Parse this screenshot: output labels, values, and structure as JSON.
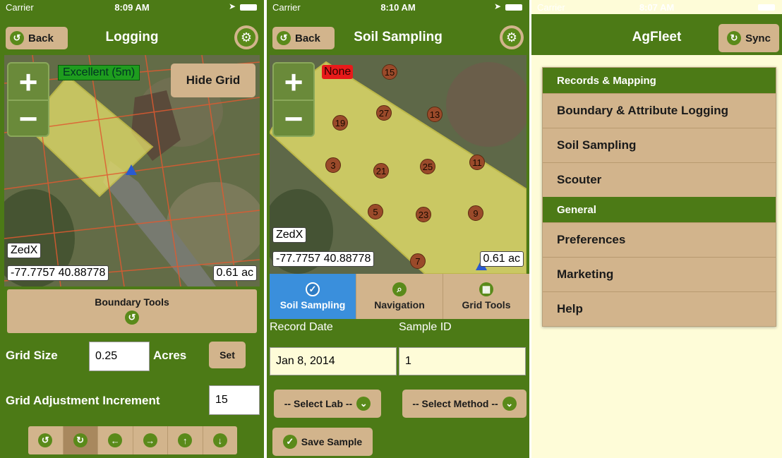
{
  "colors": {
    "nav_green": "#4c7a16",
    "tan": "#d2b48c",
    "tab_active_blue": "#3a8fdc",
    "accuracy_green": "#1e9d1e",
    "accuracy_red": "#e81a1a",
    "background_cream": "#fefcd8"
  },
  "logging": {
    "status": {
      "carrier": "Carrier",
      "time": "8:09 AM"
    },
    "back_label": "Back",
    "title": "Logging",
    "map": {
      "accuracy": "Excellent (5m)",
      "hide_grid": "Hide Grid",
      "provider": "ZedX",
      "coords": "-77.7757 40.88778",
      "area": "0.61 ac",
      "zoom_in": "+",
      "zoom_out": "−"
    },
    "boundary_tools": "Boundary Tools",
    "grid_size_label": "Grid Size",
    "grid_size_value": "0.25",
    "units": "Acres",
    "set_label": "Set",
    "increment_label": "Grid Adjustment Increment",
    "increment_value": "15",
    "arrow_icons": [
      "undo-icon",
      "redo-icon",
      "arrow-left-icon",
      "arrow-right-icon",
      "arrow-up-icon",
      "arrow-down-icon"
    ]
  },
  "soil": {
    "status": {
      "carrier": "Carrier",
      "time": "8:10 AM"
    },
    "back_label": "Back",
    "title": "Soil Sampling",
    "map": {
      "accuracy": "None",
      "provider": "ZedX",
      "coords": "-77.7757 40.88778",
      "area": "0.61 ac",
      "zoom_in": "+",
      "zoom_out": "−"
    },
    "samples": [
      "15",
      "27",
      "13",
      "19",
      "3",
      "21",
      "25",
      "11",
      "5",
      "23",
      "9",
      "7"
    ],
    "tabs": [
      {
        "label": "Soil Sampling",
        "icon": "check-icon"
      },
      {
        "label": "Navigation",
        "icon": "search-icon"
      },
      {
        "label": "Grid Tools",
        "icon": "grid-icon"
      }
    ],
    "record_date_label": "Record Date",
    "sample_id_label": "Sample ID",
    "record_date_value": "Jan 8, 2014",
    "sample_id_value": "1",
    "select_lab": "-- Select Lab --",
    "select_method": "-- Select Method --",
    "save_sample": "Save Sample"
  },
  "agfleet": {
    "status": {
      "carrier": "Carrier",
      "time": "8:07 AM"
    },
    "title": "AgFleet",
    "sync_label": "Sync",
    "sections": [
      {
        "header": "Records & Mapping",
        "items": [
          "Boundary & Attribute Logging",
          "Soil Sampling",
          "Scouter"
        ]
      },
      {
        "header": "General",
        "items": [
          "Preferences",
          "Marketing",
          "Help"
        ]
      }
    ]
  }
}
